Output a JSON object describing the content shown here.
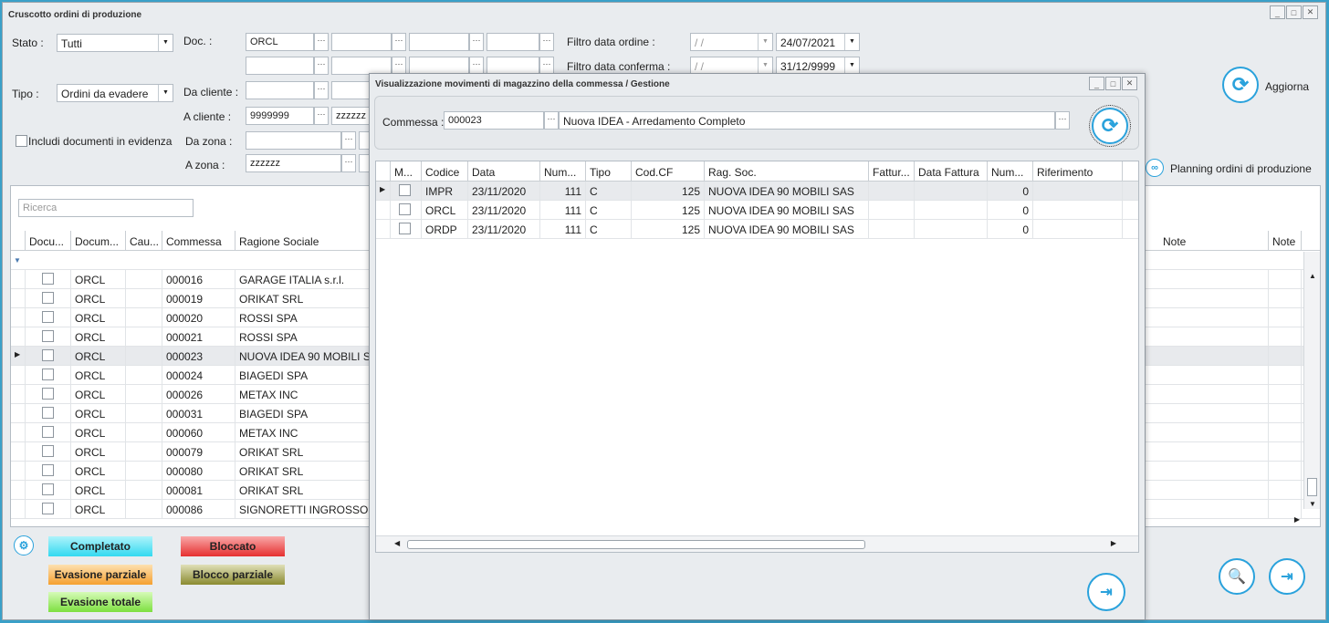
{
  "main": {
    "title": "Cruscotto ordini di produzione",
    "stato_label": "Stato :",
    "stato_value": "Tutti",
    "doc_label": "Doc. :",
    "doc_value": "ORCL",
    "tipo_label": "Tipo :",
    "tipo_value": "Ordini da evadere",
    "da_cliente_label": "Da cliente :",
    "a_cliente_label": "A cliente :",
    "a_cliente_value": "9999999",
    "a_cliente_to": "zzzzzz",
    "includi_label": "Includi documenti in evidenza",
    "da_zona_label": "Da zona :",
    "a_zona_label": "A zona :",
    "a_zona_value": "zzzzzz",
    "filtro_ordine_label": "Filtro data ordine :",
    "filtro_ordine_from": " /  / ",
    "filtro_ordine_to": "24/07/2021",
    "filtro_conferma_label": "Filtro data conferma :",
    "filtro_conferma_from": " /  / ",
    "filtro_conferma_to": "31/12/9999",
    "aggiorna_label": "Aggiorna",
    "planning_label": "Planning ordini di produzione",
    "search_placeholder": "Ricerca",
    "columns": [
      "Docu...",
      "Docum...",
      "Cau...",
      "Commessa",
      "Ragione Sociale",
      "Note",
      "Note"
    ],
    "rows": [
      {
        "doc": "ORCL",
        "commessa": "000016",
        "ragione": "GARAGE ITALIA s.r.l."
      },
      {
        "doc": "ORCL",
        "commessa": "000019",
        "ragione": "ORIKAT SRL"
      },
      {
        "doc": "ORCL",
        "commessa": "000020",
        "ragione": "ROSSI SPA"
      },
      {
        "doc": "ORCL",
        "commessa": "000021",
        "ragione": "ROSSI SPA"
      },
      {
        "doc": "ORCL",
        "commessa": "000023",
        "ragione": "NUOVA IDEA 90 MOBILI SAS"
      },
      {
        "doc": "ORCL",
        "commessa": "000024",
        "ragione": "BIAGEDI SPA"
      },
      {
        "doc": "ORCL",
        "commessa": "000026",
        "ragione": "METAX INC"
      },
      {
        "doc": "ORCL",
        "commessa": "000031",
        "ragione": "BIAGEDI SPA"
      },
      {
        "doc": "ORCL",
        "commessa": "000060",
        "ragione": "METAX INC"
      },
      {
        "doc": "ORCL",
        "commessa": "000079",
        "ragione": "ORIKAT SRL"
      },
      {
        "doc": "ORCL",
        "commessa": "000080",
        "ragione": "ORIKAT SRL"
      },
      {
        "doc": "ORCL",
        "commessa": "000081",
        "ragione": "ORIKAT SRL"
      },
      {
        "doc": "ORCL",
        "commessa": "000086",
        "ragione": "SIGNORETTI  INGROSSO FR"
      }
    ],
    "legend": {
      "completato": "Completato",
      "bloccato": "Bloccato",
      "evasione_parziale": "Evasione parziale",
      "blocco_parziale": "Blocco parziale",
      "evasione_totale": "Evasione totale"
    }
  },
  "dialog": {
    "title": "Visualizzazione movimenti di magazzino della commessa / Gestione",
    "commessa_label": "Commessa :",
    "commessa_value": "000023",
    "commessa_desc": "Nuova IDEA - Arredamento Completo",
    "columns": [
      "M...",
      "Codice",
      "Data",
      "Num...",
      "Tipo",
      "Cod.CF",
      "Rag. Soc.",
      "Fattur...",
      "Data Fattura",
      "Num...",
      "Riferimento"
    ],
    "rows": [
      {
        "codice": "IMPR",
        "data": "23/11/2020",
        "num": "111",
        "tipo": "C",
        "codcf": "125",
        "ragsoc": "NUOVA IDEA 90 MOBILI SAS",
        "num2": "0"
      },
      {
        "codice": "ORCL",
        "data": "23/11/2020",
        "num": "111",
        "tipo": "C",
        "codcf": "125",
        "ragsoc": "NUOVA IDEA 90 MOBILI SAS",
        "num2": "0"
      },
      {
        "codice": "ORDP",
        "data": "23/11/2020",
        "num": "111",
        "tipo": "C",
        "codcf": "125",
        "ragsoc": "NUOVA IDEA 90 MOBILI SAS",
        "num2": "0"
      }
    ]
  },
  "colors": {
    "accent": "#2aa2dc",
    "completato": "#33d9f0",
    "bloccato": "#e63030",
    "evasione_parziale": "#f5a030",
    "blocco_parziale": "#8a8a30",
    "evasione_totale": "#7de040"
  }
}
